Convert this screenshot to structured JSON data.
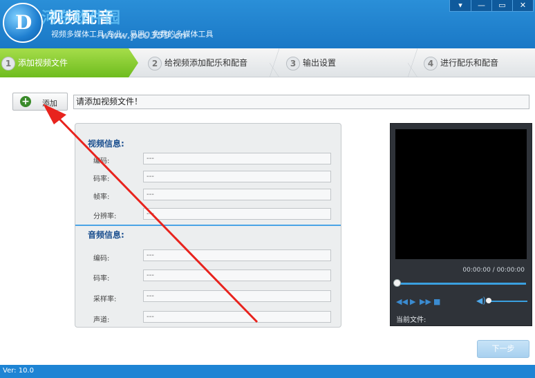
{
  "app": {
    "title": "视频配音",
    "subtitle": "视频多媒体工具 专业、易用、免费的多媒体工具",
    "watermark": "河东软件园",
    "watermark_url": "www.pc0359.cn",
    "logo_mark": "D",
    "window_controls": [
      "▾",
      "—",
      "▭",
      "✕"
    ]
  },
  "steps": [
    {
      "num": "1",
      "label": "添加视频文件",
      "active": true
    },
    {
      "num": "2",
      "label": "给视频添加配乐和配音",
      "active": false
    },
    {
      "num": "3",
      "label": "输出设置",
      "active": false
    },
    {
      "num": "4",
      "label": "进行配乐和配音",
      "active": false
    }
  ],
  "add": {
    "label": "添加",
    "file_placeholder": "请添加视频文件！"
  },
  "video_info": {
    "title": "视频信息:",
    "fields": [
      {
        "label": "编码:",
        "value": "---"
      },
      {
        "label": "码率:",
        "value": "---"
      },
      {
        "label": "帧率:",
        "value": "---"
      },
      {
        "label": "分辨率:",
        "value": "---"
      }
    ]
  },
  "audio_info": {
    "title": "音频信息:",
    "fields": [
      {
        "label": "编码:",
        "value": "---"
      },
      {
        "label": "码率:",
        "value": "---"
      },
      {
        "label": "采样率:",
        "value": "---"
      },
      {
        "label": "声道:",
        "value": "---"
      }
    ]
  },
  "player": {
    "timecode": "00:00:00 / 00:00:00",
    "current_file_label": "当前文件:",
    "progress": 0,
    "volume": 0
  },
  "next_label": "下一步",
  "version": "Ver: 10.0",
  "colors": {
    "titlebar": "#1a78c6",
    "active_step": "#6ebc1e",
    "accent": "#3aa0e0",
    "annotation_arrow": "#e8231d"
  }
}
